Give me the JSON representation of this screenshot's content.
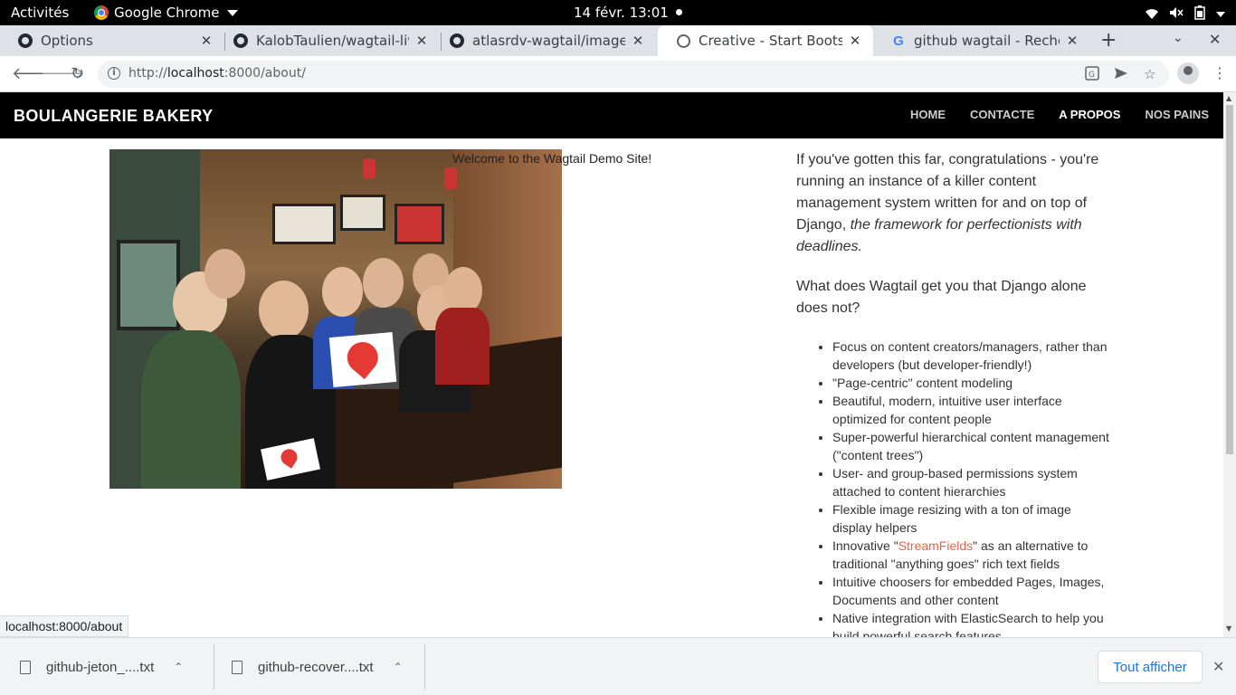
{
  "system_bar": {
    "activities": "Activités",
    "app_name": "Google Chrome",
    "clock": "14 févr.  13:01"
  },
  "tabs": [
    {
      "title": "Options",
      "icon": "github-icon",
      "active": false
    },
    {
      "title": "KalobTaulien/wagtail-live",
      "icon": "github-icon",
      "active": false
    },
    {
      "title": "atlasrdv-wagtail/images a",
      "icon": "github-icon",
      "active": false
    },
    {
      "title": "Creative - Start Bootstrap",
      "icon": "globe-icon",
      "active": true
    },
    {
      "title": "github wagtail - Recherch",
      "icon": "google-icon",
      "active": false
    }
  ],
  "omnibox": {
    "url_prefix": "http://",
    "url_host": "localhost",
    "url_rest": ":8000/about/"
  },
  "site": {
    "brand": "BOULANGERIE BAKERY",
    "nav": [
      "HOME",
      "CONTACTE",
      "A PROPOS",
      "NOS PAINS"
    ],
    "current_nav": "A PROPOS",
    "image_caption": "Welcome to the Wagtail Demo Site!",
    "intro_p1_plain": "If you've gotten this far, congratulations - you're running an instance of a killer content management system written for and on top of Django, ",
    "intro_p1_italic": "the framework for perfectionists with deadlines.",
    "intro_p2": "What does Wagtail get you that Django alone does not?",
    "features": [
      "Focus on content creators/managers, rather than developers (but developer-friendly!)",
      "\"Page-centric\" content modeling",
      "Beautiful, modern, intuitive user interface optimized for content people",
      "Super-powerful hierarchical content management (\"content trees\")",
      "User- and group-based permissions system attached to content hierarchies",
      "Flexible image resizing with a ton of image display helpers"
    ],
    "feature_streamfields_before": "Innovative \"",
    "feature_streamfields_link": "StreamFields",
    "feature_streamfields_after": "\" as an alternative to traditional \"anything goes\" rich text fields",
    "features_2": [
      "Intuitive choosers for embedded Pages, Images, Documents and other content",
      "Native integration with ElasticSearch to help you build powerful search features"
    ],
    "link_color": "#f05f40"
  },
  "status_bubble": "localhost:8000/about",
  "downloads": {
    "items": [
      "github-jeton_....txt",
      "github-recover....txt"
    ],
    "show_all": "Tout afficher"
  }
}
